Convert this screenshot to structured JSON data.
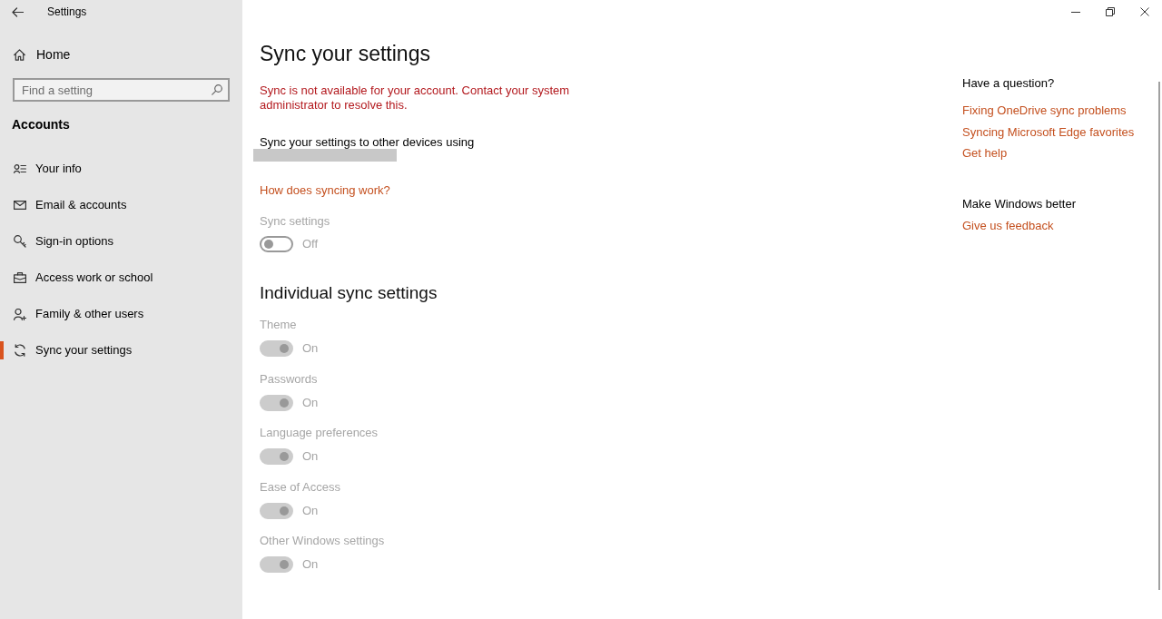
{
  "window": {
    "title": "Settings"
  },
  "sidebar": {
    "home": "Home",
    "search": {
      "placeholder": "Find a setting"
    },
    "section_title": "Accounts",
    "items": [
      {
        "label": "Your info",
        "selected": false
      },
      {
        "label": "Email & accounts",
        "selected": false
      },
      {
        "label": "Sign-in options",
        "selected": false
      },
      {
        "label": "Access work or school",
        "selected": false
      },
      {
        "label": "Family & other users",
        "selected": false
      },
      {
        "label": "Sync your settings",
        "selected": true
      }
    ]
  },
  "main": {
    "title": "Sync your settings",
    "error": "Sync is not available for your account. Contact your system administrator to resolve this.",
    "sync_description": "Sync your settings to other devices using",
    "account_email": {
      "redacted": true
    },
    "help_link": "How does syncing work?",
    "sync_toggle": {
      "label": "Sync settings",
      "on": false,
      "disabled": true,
      "state_text": "Off"
    },
    "individual": {
      "heading": "Individual sync settings",
      "toggles": [
        {
          "label": "Theme",
          "on": true,
          "disabled": true,
          "state_text": "On"
        },
        {
          "label": "Passwords",
          "on": true,
          "disabled": true,
          "state_text": "On"
        },
        {
          "label": "Language preferences",
          "on": true,
          "disabled": true,
          "state_text": "On"
        },
        {
          "label": "Ease of Access",
          "on": true,
          "disabled": true,
          "state_text": "On"
        },
        {
          "label": "Other Windows settings",
          "on": true,
          "disabled": true,
          "state_text": "On"
        }
      ]
    }
  },
  "aside": {
    "help": {
      "heading": "Have a question?",
      "links": [
        "Fixing OneDrive sync problems",
        "Syncing Microsoft Edge favorites",
        "Get help"
      ]
    },
    "feedback": {
      "heading": "Make Windows better",
      "link": "Give us feedback"
    }
  }
}
